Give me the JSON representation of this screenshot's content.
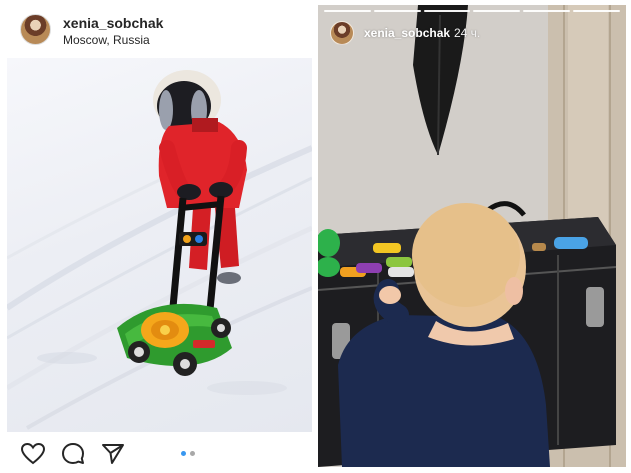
{
  "post": {
    "username": "xenia_sobchak",
    "location": "Moscow, Russia",
    "actions": {
      "like_icon": "heart-outline-icon",
      "comment_icon": "comment-bubble-icon",
      "share_icon": "paper-plane-icon"
    },
    "carousel": {
      "total": 2,
      "active": 1
    }
  },
  "story": {
    "username": "xenia_sobchak",
    "time": "24 ч.",
    "progress_segments": 6,
    "progress_done": 6
  },
  "colors": {
    "text_dark": "#262626",
    "carousel_active": "#3897f0",
    "carousel_inactive": "#a8a8a8",
    "snow": "#eef0f5"
  }
}
